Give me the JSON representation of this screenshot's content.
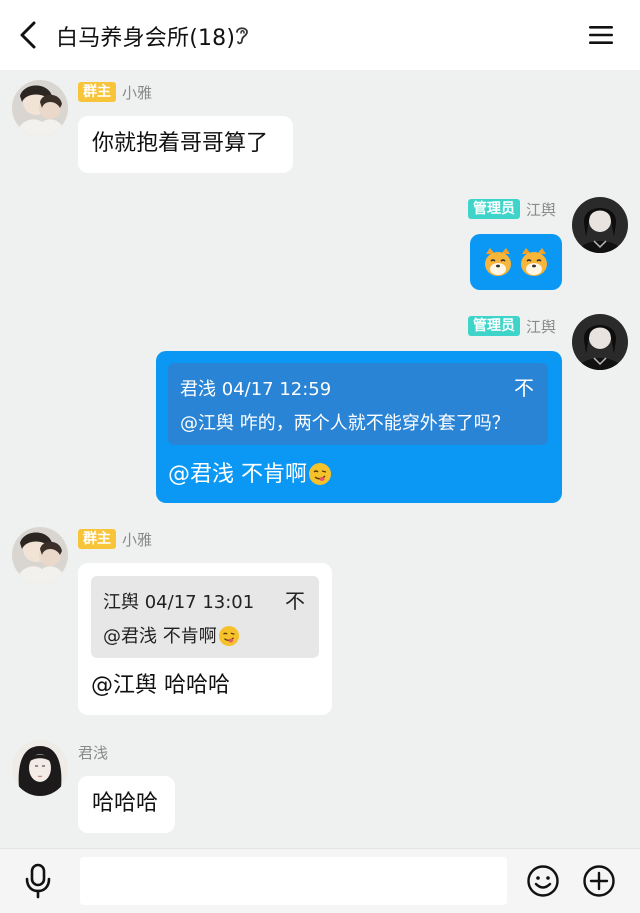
{
  "header": {
    "title": "白马养身会所(18)"
  },
  "colors": {
    "owner_badge": "#f7c43a",
    "admin_badge": "#3fd4c9",
    "bubble_blue": "#0b98f5",
    "quote_blue": "#2a84d6",
    "background": "#eef1ef"
  },
  "messages": [
    {
      "sender": "小雅",
      "role": "群主",
      "text": "你就抱着哥哥算了"
    },
    {
      "sender": "江舆",
      "role": "管理员",
      "stickers": [
        "shiba-face-icon",
        "shiba-face-icon"
      ]
    },
    {
      "sender": "江舆",
      "role": "管理员",
      "quote": {
        "author_time": "君浅 04/17 12:59",
        "text": "@江舆 咋的，两个人就不能穿外套了吗？"
      },
      "text": "@君浅 不肯啊"
    },
    {
      "sender": "小雅",
      "role": "群主",
      "quote": {
        "author_time": "江舆 04/17 13:01",
        "text": "@君浅 不肯啊"
      },
      "text": "@江舆 哈哈哈"
    },
    {
      "sender": "君浅",
      "text": "哈哈哈"
    }
  ],
  "icons": {
    "pin": "不",
    "back": "chevron-left-icon",
    "ear": "ear-icon",
    "menu": "menu-icon",
    "mic": "microphone-icon",
    "emoji": "smiley-icon",
    "plus": "plus-icon"
  },
  "input": {
    "value": "",
    "placeholder": ""
  }
}
